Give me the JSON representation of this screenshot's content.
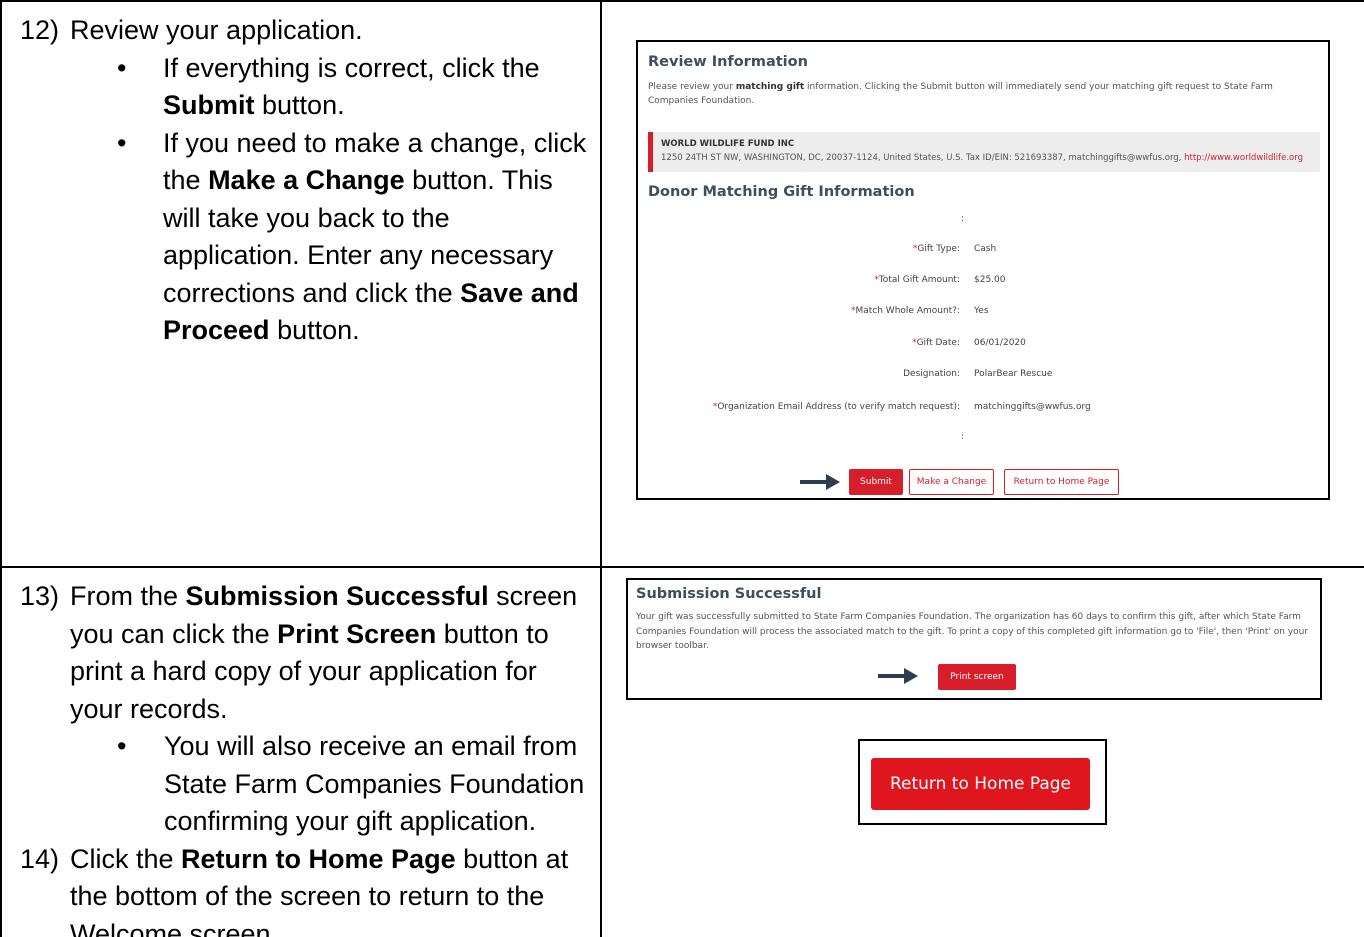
{
  "steps": {
    "step12": {
      "num": "12)",
      "title": "Review your application.",
      "bullet1_pre": "If everything is correct, click the",
      "bullet1_bold": "Submit",
      "bullet1_post": "button.",
      "bullet2_pre": "If you need to make a change, click the",
      "bullet2_bold1": "Make a Change",
      "bullet2_mid": "button. This will take you back to the application. Enter any necessary corrections and click the",
      "bullet2_bold2": "Save and Proceed",
      "bullet2_post": "button."
    },
    "step13": {
      "num": "13)",
      "pre": "From the",
      "bold1": "Submission Successful",
      "mid": "screen you can click the",
      "bold2": "Print Screen",
      "post": "button to print a hard copy of your application for your records.",
      "bullet": "You will also receive an email from State Farm Companies Foundation confirming your gift application."
    },
    "step14": {
      "num": "14)",
      "pre": "Click the",
      "bold": "Return to Home Page",
      "post": "button at the bottom of the screen to return to the Welcome screen."
    }
  },
  "review": {
    "title": "Review Information",
    "intro_pre": "Please review your",
    "intro_bold": "matching gift",
    "intro_post": "information. Clicking the Submit button will immediately send your matching gift request to State Farm Companies Foundation.",
    "org_name": "WORLD WILDLIFE FUND INC",
    "org_address": "1250 24TH ST NW, WASHINGTON, DC, 20037-1124, United States, U.S. Tax ID/EIN: 521693387, matchinggifts@wwfus.org,",
    "org_url": "http://www.worldwildlife.org",
    "section_title": "Donor Matching Gift Information",
    "blank_sep": ":",
    "fields": [
      {
        "label": "Gift Type:",
        "value": "Cash",
        "required": "*"
      },
      {
        "label": "Total Gift Amount:",
        "value": "$25.00",
        "required": "*"
      },
      {
        "label": "Match Whole Amount?:",
        "value": "Yes",
        "required": "*"
      },
      {
        "label": "Gift Date:",
        "value": "06/01/2020",
        "required": "*"
      },
      {
        "label": "Designation:",
        "value": "PolarBear Rescue",
        "required": ""
      },
      {
        "label": "Organization Email Address (to verify match request):",
        "value": "matchinggifts@wwfus.org",
        "required": "*"
      }
    ],
    "buttons": {
      "submit": "Submit",
      "make_change": "Make a Change",
      "return_home": "Return to Home Page"
    }
  },
  "success": {
    "title": "Submission Successful",
    "text": "Your gift was successfully submitted to State Farm Companies Foundation. The organization has 60 days to confirm this gift, after which State Farm Companies Foundation will process the associated match to the gift. To print a copy of this completed gift information go to 'File', then 'Print' on your browser toolbar.",
    "print_button": "Print screen"
  },
  "home_button": "Return to Home Page",
  "colors": {
    "brand_red": "#d61f2a",
    "heading_gray": "#3d4f5c",
    "arrow_navy": "#2d3e50"
  }
}
